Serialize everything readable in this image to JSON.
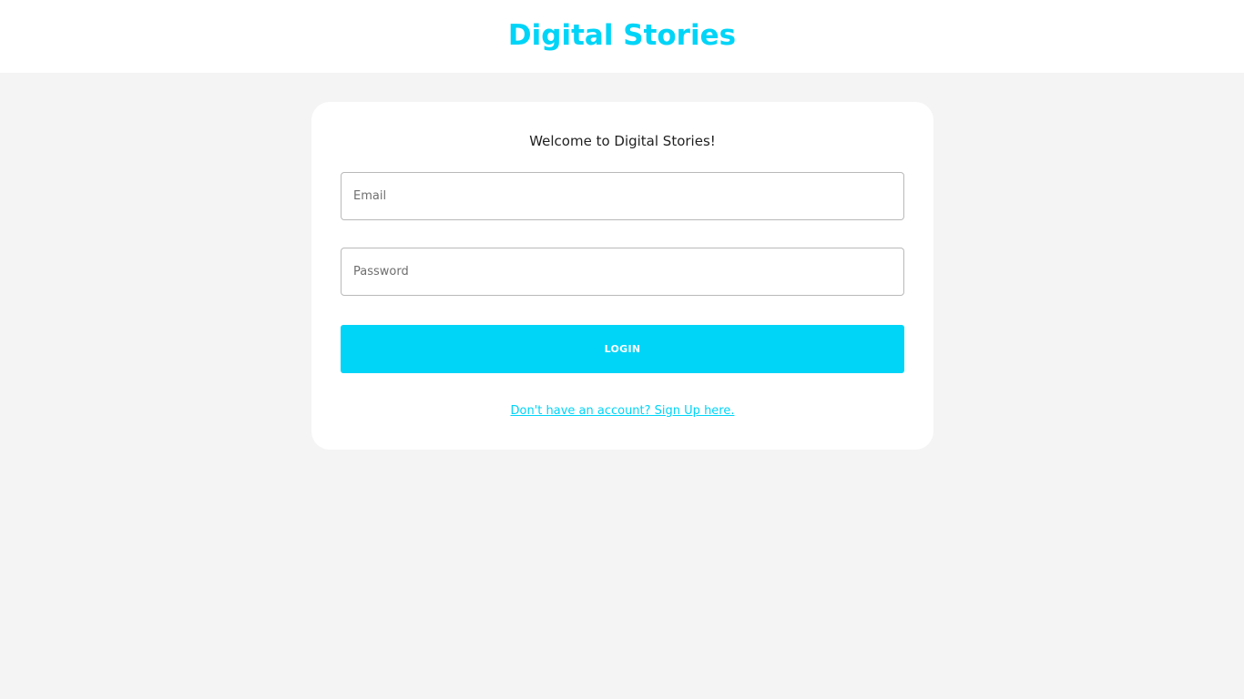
{
  "header": {
    "title": "Digital Stories"
  },
  "login_card": {
    "welcome_text": "Welcome to Digital Stories!",
    "email_placeholder": "Email",
    "email_value": "",
    "password_placeholder": "Password",
    "password_value": "",
    "login_label": "LOGIN",
    "signup_link": "Don't have an account? Sign Up here."
  },
  "colors": {
    "accent": "#00d4f7",
    "page_background": "#f4f4f4",
    "card_background": "#ffffff",
    "text": "#1f1f1f"
  }
}
